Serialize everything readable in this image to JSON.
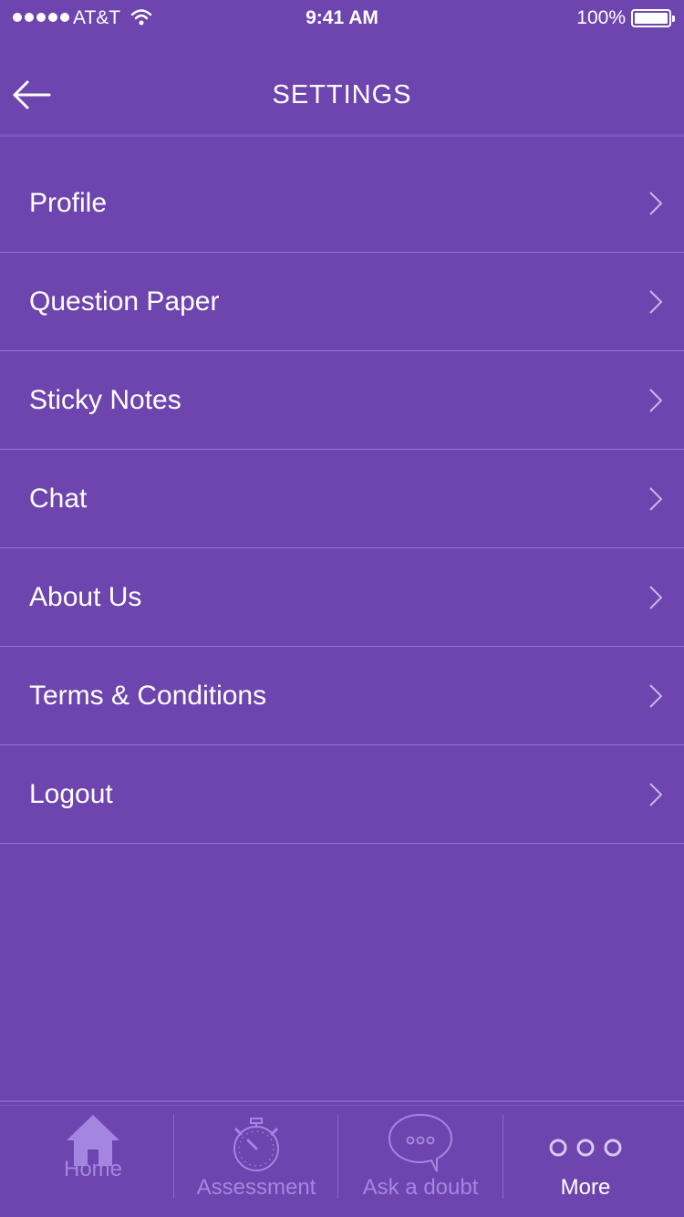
{
  "status_bar": {
    "carrier": "AT&T",
    "time": "9:41 AM",
    "battery": "100%"
  },
  "nav": {
    "title": "SETTINGS",
    "back_icon": "arrow-left-icon"
  },
  "menu": [
    {
      "label": "Profile"
    },
    {
      "label": "Question Paper"
    },
    {
      "label": "Sticky Notes"
    },
    {
      "label": "Chat"
    },
    {
      "label": "About Us"
    },
    {
      "label": "Terms & Conditions"
    },
    {
      "label": "Logout"
    }
  ],
  "tabs": [
    {
      "label": "Home",
      "icon": "home-icon",
      "active": false
    },
    {
      "label": "Assessment",
      "icon": "stopwatch-icon",
      "active": false
    },
    {
      "label": "Ask a doubt",
      "icon": "speech-bubble-icon",
      "active": false
    },
    {
      "label": "More",
      "icon": "more-dots-icon",
      "active": true
    }
  ],
  "colors": {
    "background": "#6e45ae",
    "divider": "#9679cc",
    "inactive_tab": "#a486e0",
    "active_tab": "#ffffff"
  }
}
